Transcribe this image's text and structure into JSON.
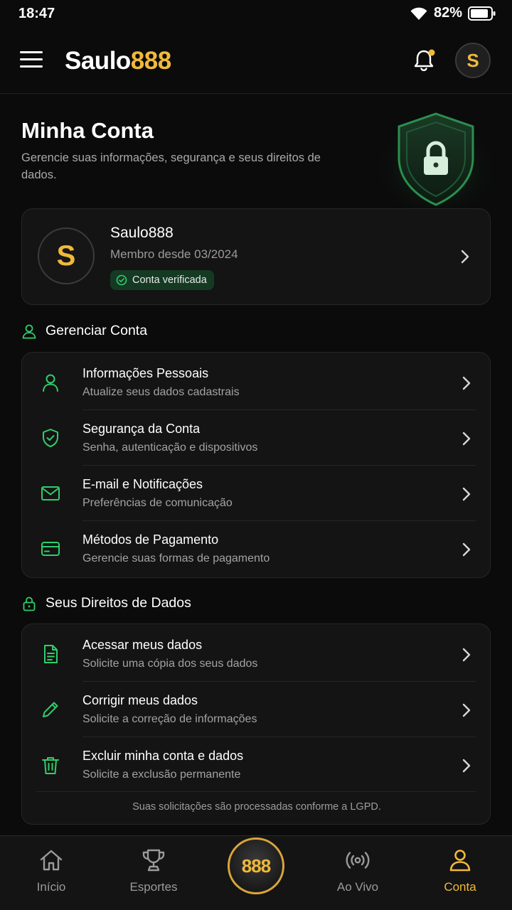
{
  "status_bar": {
    "time": "18:47",
    "battery": "82%"
  },
  "app_bar": {
    "brand_white": "Saulo",
    "brand_gold": "888",
    "avatar_letter": "S"
  },
  "header": {
    "title": "Minha Conta",
    "subtitle": "Gerencie suas informações, segurança e seus direitos de dados."
  },
  "profile": {
    "avatar_letter": "S",
    "name": "Saulo888",
    "member_since": "Membro desde 03/2024",
    "verified_label": "Conta verificada"
  },
  "manage_section": {
    "title": "Gerenciar Conta",
    "items": [
      {
        "title": "Informações Pessoais",
        "subtitle": "Atualize seus dados cadastrais",
        "icon": "user-icon"
      },
      {
        "title": "Segurança da Conta",
        "subtitle": "Senha, autenticação e dispositivos",
        "icon": "shield-check-icon"
      },
      {
        "title": "E-mail e Notificações",
        "subtitle": "Preferências de comunicação",
        "icon": "mail-icon"
      },
      {
        "title": "Métodos de Pagamento",
        "subtitle": "Gerencie suas formas de pagamento",
        "icon": "credit-card-icon"
      }
    ]
  },
  "data_rights_section": {
    "title": "Seus Direitos de Dados",
    "items": [
      {
        "title": "Acessar meus dados",
        "subtitle": "Solicite uma cópia dos seus dados",
        "icon": "document-icon"
      },
      {
        "title": "Corrigir meus dados",
        "subtitle": "Solicite a correção de informações",
        "icon": "pencil-icon"
      },
      {
        "title": "Excluir minha conta e dados",
        "subtitle": "Solicite a exclusão permanente",
        "icon": "trash-icon"
      }
    ],
    "note": "Suas solicitações são processadas conforme a LGPD."
  },
  "bottom_nav": {
    "items": [
      {
        "label": "Início",
        "icon": "home-icon"
      },
      {
        "label": "Esportes",
        "icon": "trophy-icon"
      },
      {
        "label": "Ao Vivo",
        "icon": "live-icon"
      },
      {
        "label": "Conta",
        "icon": "account-icon"
      }
    ],
    "center_label": "888",
    "active": "Conta"
  },
  "colors": {
    "accent_gold": "#f0b93a",
    "accent_green": "#2fce6a",
    "background": "#0b0b0b",
    "card": "#141414"
  }
}
